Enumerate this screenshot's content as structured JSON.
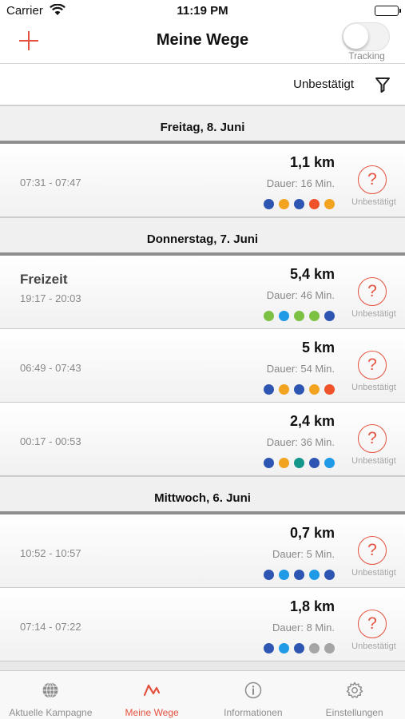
{
  "status_bar": {
    "carrier": "Carrier",
    "time": "11:19 PM"
  },
  "nav": {
    "title": "Meine Wege",
    "tracking_label": "Tracking",
    "tracking_on": false
  },
  "filter": {
    "label": "Unbestätigt"
  },
  "colors": {
    "accent": "#e5513f",
    "dark_blue": "#2f55b3",
    "light_blue": "#1e9ae6",
    "orange": "#f2a421",
    "red_orange": "#f0522a",
    "green": "#7cc044",
    "teal": "#15968a",
    "grey": "#a5a5a5"
  },
  "sections": [
    {
      "title": "Freitag, 8. Juni",
      "trips": [
        {
          "purpose": "",
          "time": "07:31 - 07:47",
          "distance": "1,1 km",
          "duration": "Dauer: 16 Min.",
          "status": "Unbestätigt",
          "status_icon": "?",
          "modes": [
            "#2f55b3",
            "#f2a421",
            "#2f55b3",
            "#f0522a",
            "#f2a421"
          ]
        }
      ]
    },
    {
      "title": "Donnerstag, 7. Juni",
      "trips": [
        {
          "purpose": "Freizeit",
          "time": "19:17 - 20:03",
          "distance": "5,4 km",
          "duration": "Dauer: 46 Min.",
          "status": "Unbestätigt",
          "status_icon": "?",
          "modes": [
            "#7cc044",
            "#1e9ae6",
            "#7cc044",
            "#7cc044",
            "#2f55b3"
          ]
        },
        {
          "purpose": "",
          "time": "06:49 - 07:43",
          "distance": "5 km",
          "duration": "Dauer: 54 Min.",
          "status": "Unbestätigt",
          "status_icon": "?",
          "modes": [
            "#2f55b3",
            "#f2a421",
            "#2f55b3",
            "#f2a421",
            "#f0522a"
          ]
        },
        {
          "purpose": "",
          "time": "00:17 - 00:53",
          "distance": "2,4 km",
          "duration": "Dauer: 36 Min.",
          "status": "Unbestätigt",
          "status_icon": "?",
          "modes": [
            "#2f55b3",
            "#f2a421",
            "#15968a",
            "#2f55b3",
            "#1e9ae6"
          ]
        }
      ]
    },
    {
      "title": "Mittwoch, 6. Juni",
      "trips": [
        {
          "purpose": "",
          "time": "10:52 - 10:57",
          "distance": "0,7 km",
          "duration": "Dauer: 5 Min.",
          "status": "Unbestätigt",
          "status_icon": "?",
          "modes": [
            "#2f55b3",
            "#1e9ae6",
            "#2f55b3",
            "#1e9ae6",
            "#2f55b3"
          ]
        },
        {
          "purpose": "",
          "time": "07:14 - 07:22",
          "distance": "1,8 km",
          "duration": "Dauer: 8 Min.",
          "status": "Unbestätigt",
          "status_icon": "?",
          "modes": [
            "#2f55b3",
            "#1e9ae6",
            "#2f55b3",
            "#a5a5a5",
            "#a5a5a5"
          ]
        }
      ]
    }
  ],
  "tabs": [
    {
      "label": "Aktuelle Kampagne",
      "icon": "globe-icon",
      "active": false
    },
    {
      "label": "Meine Wege",
      "icon": "route-icon",
      "active": true
    },
    {
      "label": "Informationen",
      "icon": "info-icon",
      "active": false
    },
    {
      "label": "Einstellungen",
      "icon": "gear-icon",
      "active": false
    }
  ]
}
